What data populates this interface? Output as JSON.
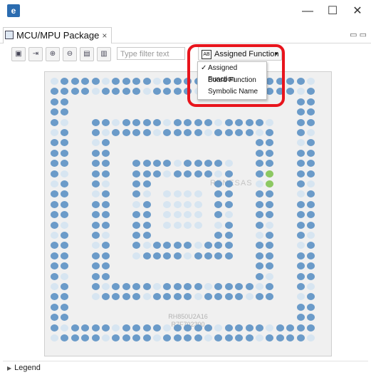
{
  "window": {
    "minimize_glyph": "—",
    "maximize_glyph": "☐",
    "close_glyph": "✕"
  },
  "tab": {
    "label": "MCU/MPU Package",
    "close_glyph": "×",
    "icon": "package-icon"
  },
  "toolbar": {
    "filter_placeholder": "Type filter text",
    "dropdown": {
      "icon_text": "AB",
      "label": "Assigned Function",
      "arrow": "▾"
    },
    "buttons": [
      "save-icon",
      "export-icon",
      "zoom-in-icon",
      "zoom-out-icon",
      "page-icon",
      "page-alt-icon"
    ]
  },
  "menu": {
    "check_glyph": "✓",
    "items": [
      {
        "label": "Assigned Function",
        "checked": true
      },
      {
        "label": "Board Function",
        "checked": false
      },
      {
        "label": "Symbolic Name",
        "checked": false
      }
    ]
  },
  "package": {
    "logo": "RENESAS",
    "part_name": "RH850U2A16",
    "part_number": "R7F702300"
  },
  "legend": {
    "label": "Legend"
  },
  "colors": {
    "pin_assigned": "#6b9bc9",
    "pin_unassigned": "#d7e5f1",
    "pin_selected": "#8cc862",
    "highlight": "#e8141c"
  }
}
